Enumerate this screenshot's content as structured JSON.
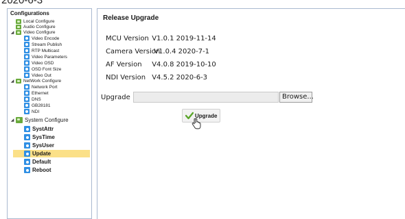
{
  "header_fragment": "2020-6-3",
  "sidebar": {
    "title": "Configurations",
    "items": [
      {
        "label": "Local Configure"
      },
      {
        "label": "Audio Configure"
      },
      {
        "label": "Video Configure"
      },
      {
        "label": "Video Encode"
      },
      {
        "label": "Stream Publish"
      },
      {
        "label": "RTP Multicast"
      },
      {
        "label": "Video Parameters"
      },
      {
        "label": "Video OSD"
      },
      {
        "label": "OSD Font Size"
      },
      {
        "label": "Video Out"
      },
      {
        "label": "NetWork Configure"
      },
      {
        "label": "Network Port"
      },
      {
        "label": "Ethernet"
      },
      {
        "label": "DNS"
      },
      {
        "label": "GB28181"
      },
      {
        "label": "NDI"
      },
      {
        "label": "System Configure"
      },
      {
        "label": "SystAttr"
      },
      {
        "label": "SysTime"
      },
      {
        "label": "SysUser"
      },
      {
        "label": "Update"
      },
      {
        "label": "Default"
      },
      {
        "label": "Reboot"
      }
    ],
    "selected": "Update"
  },
  "main": {
    "title": "Release Upgrade",
    "versions": [
      {
        "label": "MCU Version",
        "value": "V1.0.1  2019-11-14"
      },
      {
        "label": "Camera Version",
        "value": "V1.0.4  2020-7-1"
      },
      {
        "label": "AF Version",
        "value": "V4.0.8  2019-10-10"
      },
      {
        "label": "NDI Version",
        "value": "V4.5.2  2020-6-3"
      }
    ],
    "upgrade_label": "Upgrade",
    "file_value": "",
    "browse_label": "Browse...",
    "upgrade_button_label": "Upgrade"
  },
  "colors": {
    "selected_highlight": "#fbe088",
    "folder_icon": "#6aaa3c",
    "leaf_icon": "#2f8fe4",
    "border": "#a9b9cf"
  }
}
